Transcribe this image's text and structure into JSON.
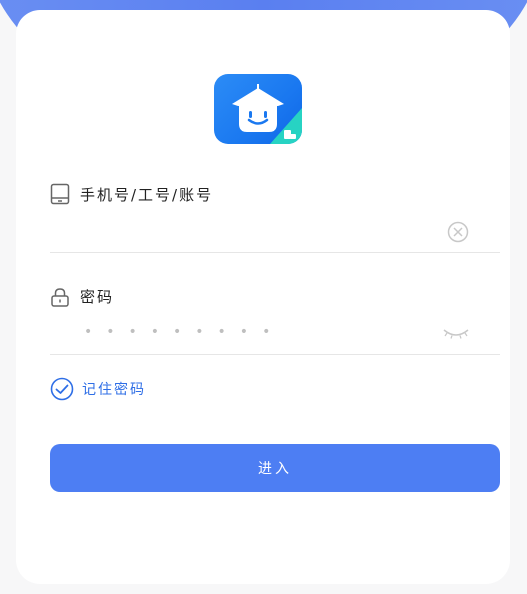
{
  "brand": {
    "primary": "#4d7ef3",
    "link": "#2e6ee6",
    "logo_icon": "school-house-icon"
  },
  "login": {
    "account_label": "手机号/工号/账号",
    "account_icon": "tablet-icon",
    "account_value": "",
    "account_placeholder": "",
    "clear_icon": "clear-circle-icon",
    "password_label": "密码",
    "password_icon": "lock-icon",
    "password_mask": "•••••••••",
    "eye_icon": "eye-closed-icon",
    "remember_label": "记住密码",
    "remember_checked": true,
    "remember_icon": "check-circle-icon",
    "submit_label": "进入"
  }
}
